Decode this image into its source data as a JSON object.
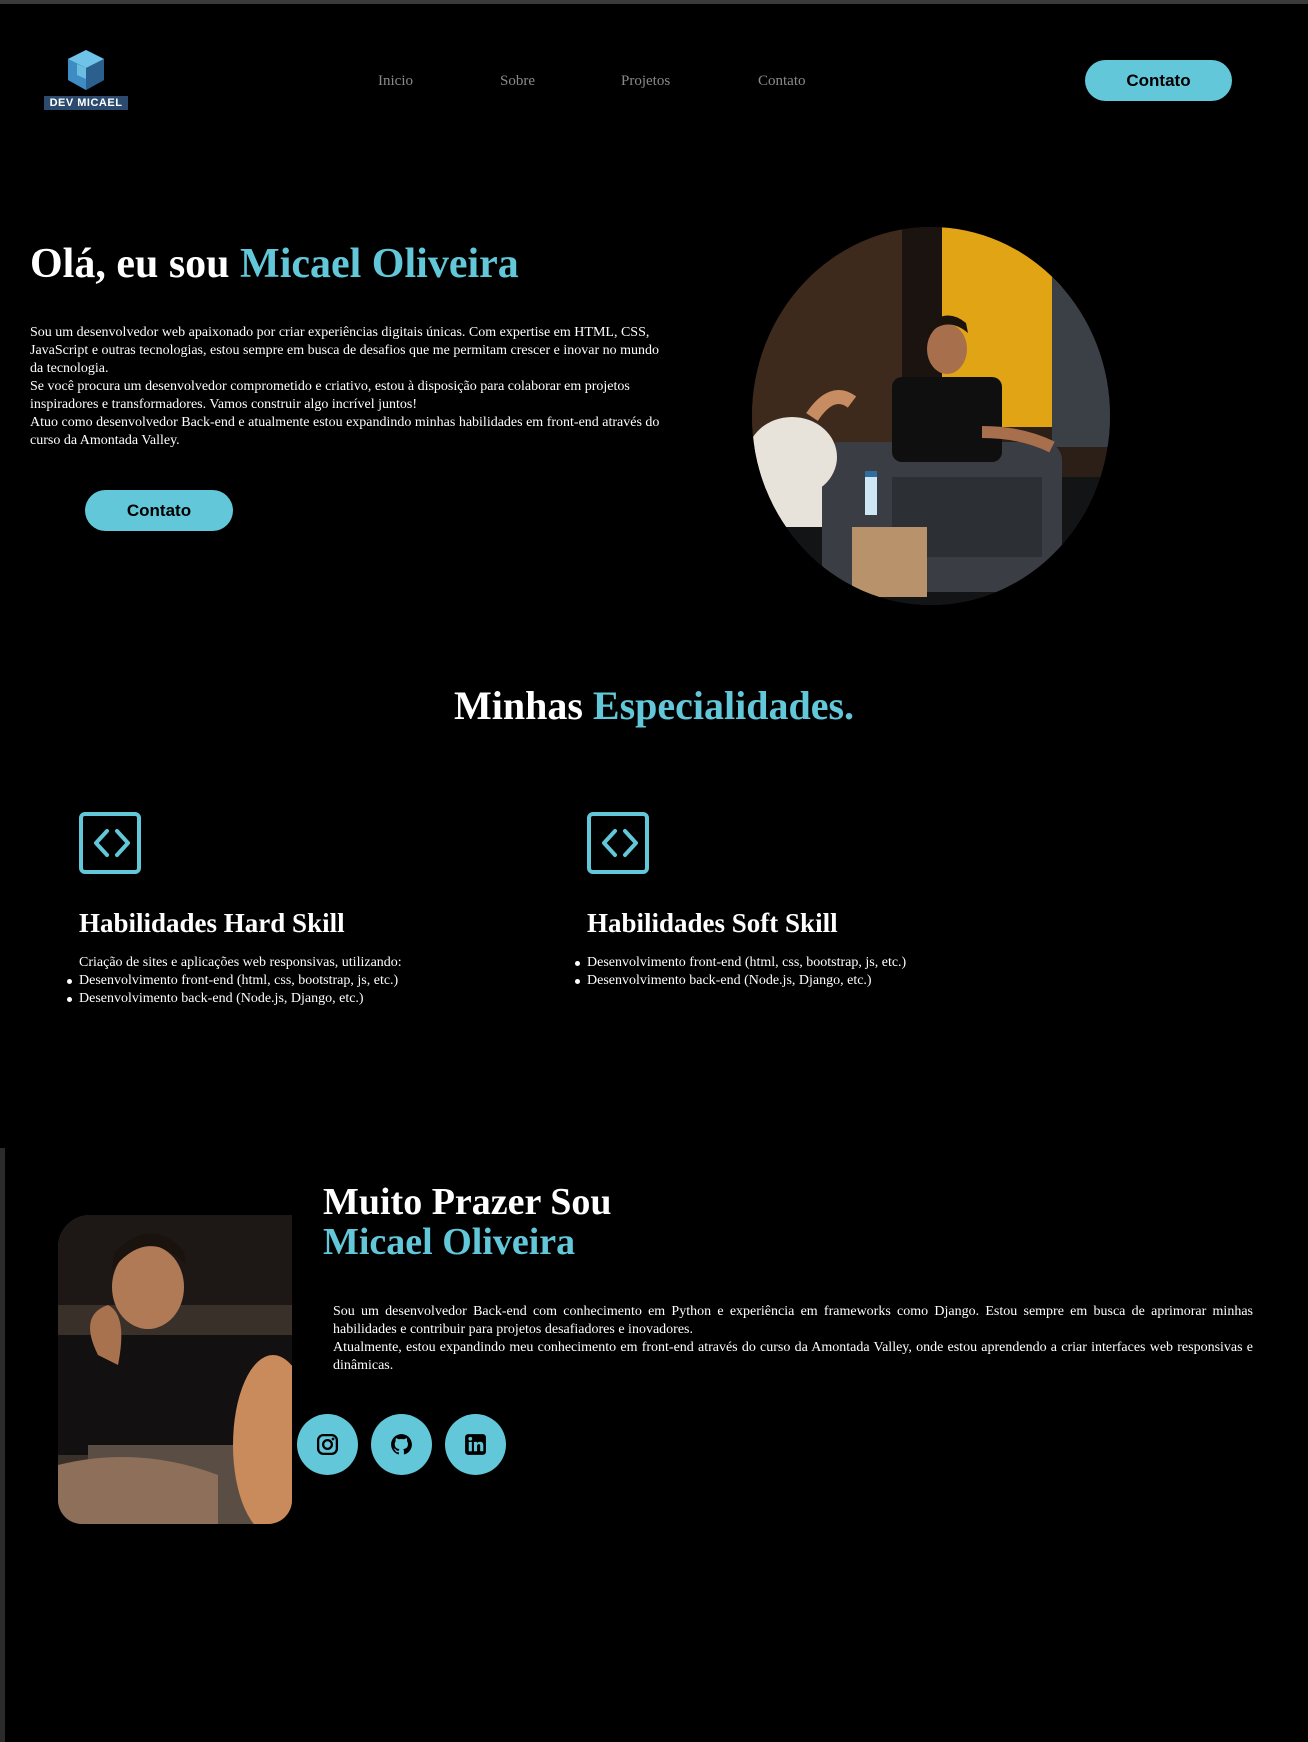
{
  "header": {
    "logo_text": "DEV MICAEL",
    "nav": [
      "Inicio",
      "Sobre",
      "Projetos",
      "Contato"
    ],
    "cta_label": "Contato"
  },
  "hero": {
    "title_prefix": "Olá, eu sou ",
    "title_name": "Micael Oliveira",
    "paragraph_1": "Sou um desenvolvedor web apaixonado por criar experiências digitais únicas. Com expertise em HTML, CSS, JavaScript e outras tecnologias, estou sempre em busca de desafios que me permitam crescer e inovar no mundo da tecnologia.",
    "paragraph_2": "Se você procura um desenvolvedor comprometido e criativo, estou à disposição para colaborar em projetos inspiradores e transformadores. Vamos construir algo incrível juntos!",
    "paragraph_3": "Atuo como desenvolvedor Back-end e atualmente estou expandindo minhas habilidades em front-end através do curso da Amontada Valley.",
    "button_label": "Contato"
  },
  "specialities": {
    "title_prefix": "Minhas ",
    "title_accent": "Especialidades.",
    "cards": [
      {
        "title": "Habilidades Hard Skill",
        "intro": "Criação de sites e aplicações web responsivas, utilizando:",
        "items": [
          "Desenvolvimento front-end (html, css, bootstrap, js, etc.)",
          "Desenvolvimento back-end (Node.js, Django, etc.)"
        ]
      },
      {
        "title": "Habilidades Soft Skill",
        "items": [
          "Desenvolvimento front-end (html, css, bootstrap, js, etc.)",
          "Desenvolvimento back-end (Node.js, Django, etc.)"
        ]
      }
    ]
  },
  "about": {
    "title_line1": "Muito Prazer Sou",
    "title_line2": "Micael Oliveira",
    "paragraph_1": "Sou um desenvolvedor Back-end com conhecimento em Python e experiência em frameworks como Django. Estou sempre em busca de aprimorar minhas habilidades e contribuir para projetos desafiadores e inovadores.",
    "paragraph_2": "Atualmente, estou expandindo meu conhecimento em front-end através do curso da Amontada Valley, onde estou aprendendo a criar interfaces web responsivas e dinâmicas.",
    "socials": [
      "instagram-icon",
      "github-icon",
      "linkedin-icon"
    ]
  },
  "colors": {
    "accent": "#61c7d9",
    "background": "#000000"
  }
}
